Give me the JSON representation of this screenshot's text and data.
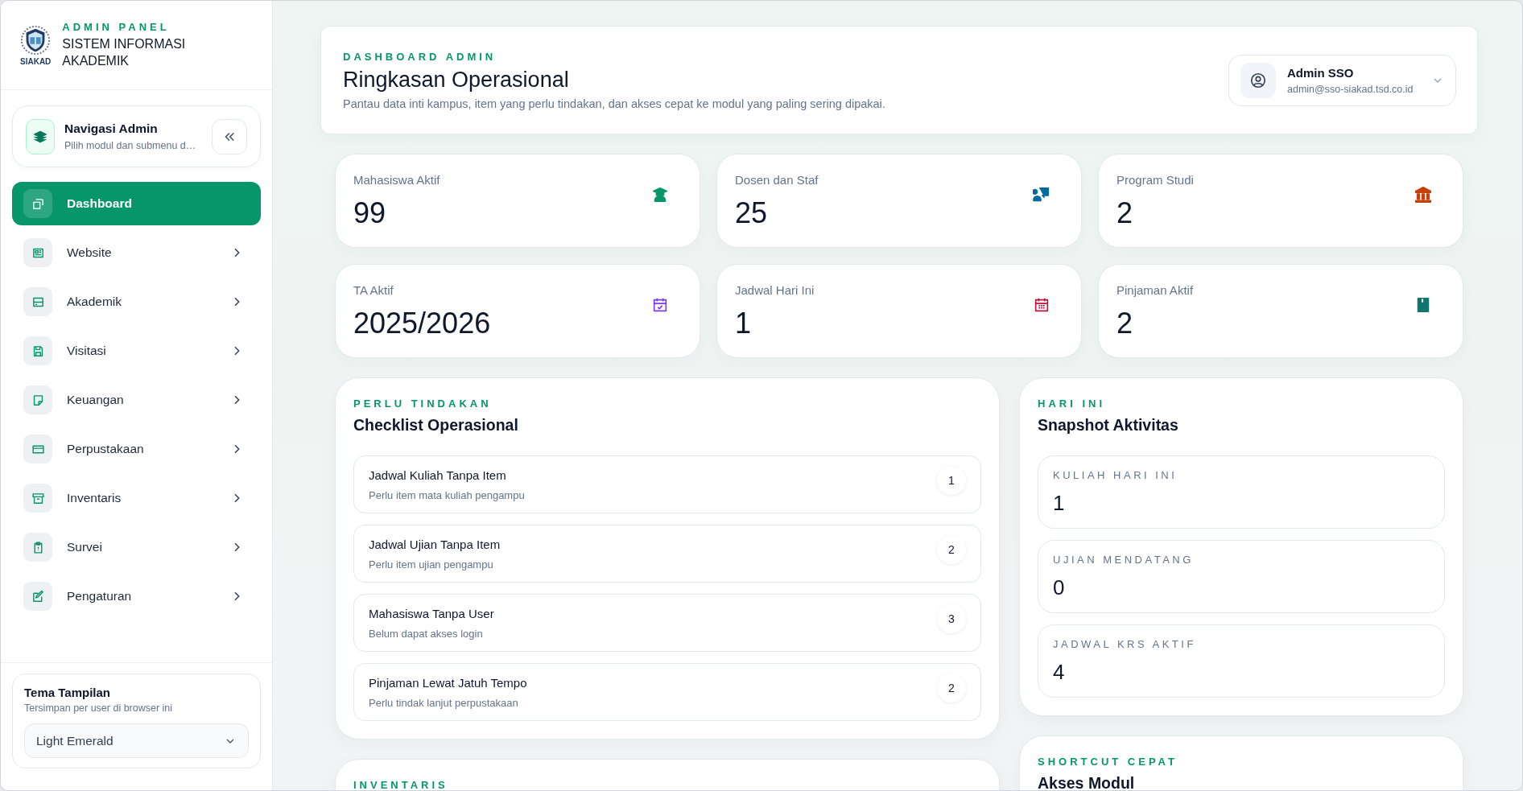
{
  "brand": {
    "eyebrow": "ADMIN PANEL",
    "title": "SISTEM INFORMASI AKADEMIK",
    "logo_text": "SIAKAD"
  },
  "nav_header": {
    "title": "Navigasi Admin",
    "subtitle": "Pilih modul dan submenu d…"
  },
  "nav": [
    {
      "label": "Dashboard",
      "selected": true,
      "has_submenu": false
    },
    {
      "label": "Website",
      "selected": false,
      "has_submenu": true
    },
    {
      "label": "Akademik",
      "selected": false,
      "has_submenu": true
    },
    {
      "label": "Visitasi",
      "selected": false,
      "has_submenu": true
    },
    {
      "label": "Keuangan",
      "selected": false,
      "has_submenu": true
    },
    {
      "label": "Perpustakaan",
      "selected": false,
      "has_submenu": true
    },
    {
      "label": "Inventaris",
      "selected": false,
      "has_submenu": true
    },
    {
      "label": "Survei",
      "selected": false,
      "has_submenu": true
    },
    {
      "label": "Pengaturan",
      "selected": false,
      "has_submenu": true
    }
  ],
  "theme": {
    "title": "Tema Tampilan",
    "subtitle": "Tersimpan per user di browser ini",
    "value": "Light Emerald"
  },
  "header": {
    "eyebrow": "DASHBOARD ADMIN",
    "title": "Ringkasan Operasional",
    "subtitle": "Pantau data inti kampus, item yang perlu tindakan, dan akses cepat ke modul yang paling sering dipakai.",
    "user": {
      "name": "Admin SSO",
      "email": "admin@sso-siakad.tsd.co.id"
    }
  },
  "stats": [
    {
      "label": "Mahasiswa Aktif",
      "value": "99",
      "color": "#059669"
    },
    {
      "label": "Dosen dan Staf",
      "value": "25",
      "color": "#0369a1"
    },
    {
      "label": "Program Studi",
      "value": "2",
      "color": "#c2410c"
    },
    {
      "label": "TA Aktif",
      "value": "2025/2026",
      "color": "#7c3aed"
    },
    {
      "label": "Jadwal Hari Ini",
      "value": "1",
      "color": "#be123c"
    },
    {
      "label": "Pinjaman Aktif",
      "value": "2",
      "color": "#0f766e"
    }
  ],
  "checklist": {
    "eyebrow": "PERLU TINDAKAN",
    "title": "Checklist Operasional",
    "items": [
      {
        "title": "Jadwal Kuliah Tanpa Item",
        "subtitle": "Perlu item mata kuliah pengampu",
        "count": "1"
      },
      {
        "title": "Jadwal Ujian Tanpa Item",
        "subtitle": "Perlu item ujian pengampu",
        "count": "2"
      },
      {
        "title": "Mahasiswa Tanpa User",
        "subtitle": "Belum dapat akses login",
        "count": "3"
      },
      {
        "title": "Pinjaman Lewat Jatuh Tempo",
        "subtitle": "Perlu tindak lanjut perpustakaan",
        "count": "2"
      }
    ]
  },
  "snapshot": {
    "eyebrow": "HARI INI",
    "title": "Snapshot Aktivitas",
    "items": [
      {
        "label": "KULIAH HARI INI",
        "value": "1"
      },
      {
        "label": "UJIAN MENDATANG",
        "value": "0"
      },
      {
        "label": "JADWAL KRS AKTIF",
        "value": "4"
      }
    ]
  },
  "inventory": {
    "eyebrow": "INVENTARIS"
  },
  "shortcut": {
    "eyebrow": "SHORTCUT CEPAT",
    "title": "Akses Modul"
  }
}
